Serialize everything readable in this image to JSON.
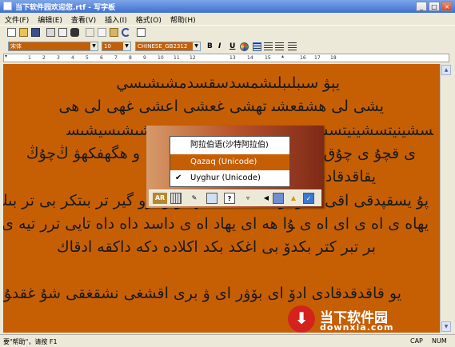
{
  "window": {
    "title": "当下软件园欢迎您.rtf - 写字板",
    "minimize_glyph": "_",
    "maximize_glyph": "□",
    "close_glyph": "×"
  },
  "menu": [
    "文件(F)",
    "编辑(E)",
    "查看(V)",
    "插入(I)",
    "格式(O)",
    "帮助(H)"
  ],
  "format_toolbar": {
    "font_name": "宋体",
    "font_size": "10",
    "script": "CHINESE_GB2312",
    "bold": "B",
    "italic": "I",
    "underline": "U"
  },
  "ruler_labels": [
    "1",
    "2",
    "3",
    "4",
    "5",
    "6",
    "7",
    "8",
    "9",
    "10",
    "11",
    "12",
    "13",
    "14",
    "15",
    "16",
    "17",
    "18"
  ],
  "document": {
    "background": "#c65f04",
    "lines": [
      "يېۋ ﺳﯩﺒﻠﯩﺒﻠﯩﺸﻤﺴﺪﺳﻘﺴﺪﻣﺸﯩﺸﯩﺴﻲ",
      "يشى ﻟﻰ ﮬﺸﻘﻌﺸﯩ ﺗﻬﺸﻰ ﻏﻌﺸﻰ ﺍﻋﺸﻰ ﻏﻬﻰ ﻟﻰ ﻫﻰ",
      "ﺷﯩﺸﯩﺴﻴﺸﯩﺴ",
      "ﺴﺸﻴﻨﻴﺘﺴﺸﻴﻨﻴﺘﺴﺸﻨﻨﺖ",
      "و ﮬﮕﮭﻔﻜﮭﯟ ﯓﭼﯘﯓ",
      "ﻯ ﻗﭽﯘ ﻯ ﭼﯘﻕ ﯓﭻ ﺍ",
      "ﻳﻘﺎﻗﺪﻗﺎﺩﻯ ﺍﺩﻗﺎﻯ ﺩﺩﻕ",
      "ﭘﯘ ﻳﺴﻘﭙﺪﻗﻰ ﺍﻗﻰ ﻳﮧﺩﯙ ﺑﯘ ﺑﻰ ﻳﻜﻤﺴﻴﺴﻬﻴﯩﺆ ﻭ ﺑﺮﻭ ﮔﻴﺮ ﺗﺮ ﺑﯩﺘﻜﺮ ﺑﻰ ﺗﺮ ﺑﯩﻚ",
      "ﻳﮭﺎﻩ ﻯ ﺍﻩ ﻯ ﺍﻯ ﺍﻩ ﻯ ﯘﺍ ﻫﻪ ﺍﻯ ﻳﻬﺎﺩ ﺍﻩ ﻯ ﺩﺍﺳﺪ ﺩﺍﻩ ﺩﺍﻩ ﺗﺎﻳﻰ ﺗﺮﺭ ﺗﻴﻪ ﻯ ﻩ ﻯ ﻕ",
      "ﺑﺮ ﺗﺒﺮ ﻛﺘﺮ ﺑﻜﺪﯙ ﺑﻰ ﺍﻏﻜﺪ ﺑﻜﺪ ﺍﻛﻼﺩﻩ ﺩﻛﻪ ﺩﺍﻛﻘﻪ ﺍﺩﻗﺎﻙ",
      "ﻳﻮ ﻗﺎﻗﺪﻗﺪﻗﺎﺩﻯ ﺍﺩﯙ ﺍﻯ ﺑﯚﯞﺭ ﺍﻯ ﯞ ﺑﺮﻯ ﺍﻗﺸﻐﻰ ﻧﺸﻘﻐﻘﻰ ﺷﯘ ﻏﻘﺪﯘﺱ"
    ]
  },
  "ime_menu": {
    "items": [
      {
        "label": "阿拉伯语(沙特阿拉伯)",
        "checked": false,
        "highlighted": false
      },
      {
        "label": "Qazaq (Unicode)",
        "checked": false,
        "highlighted": true
      },
      {
        "label": "Uyghur (Unicode)",
        "checked": true,
        "highlighted": false
      }
    ],
    "check_glyph": "✔",
    "language_indicator": "AR",
    "help_glyph": "?"
  },
  "status": {
    "help_text": "要\"帮助\"，请按 F1",
    "cap": "CAP",
    "num": "NUM"
  },
  "watermark": {
    "brand": "当下软件园",
    "url": "downxia.com"
  }
}
